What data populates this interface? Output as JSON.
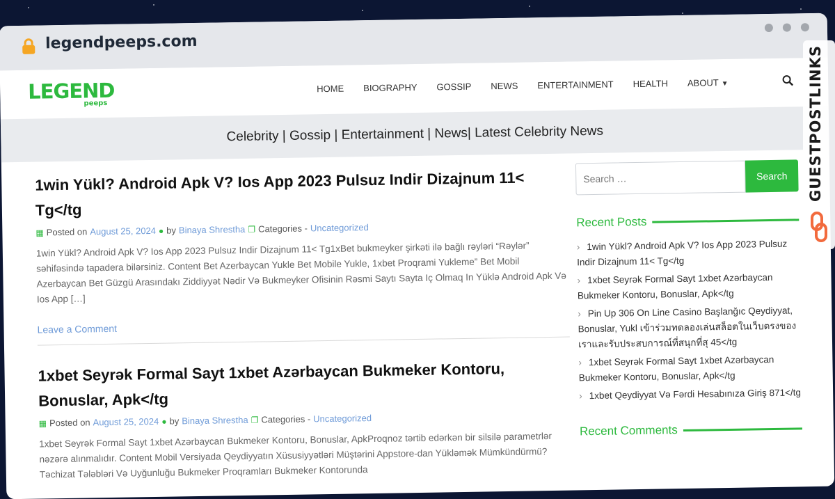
{
  "browser": {
    "address": "legendpeeps.com"
  },
  "site": {
    "logo_text": "LEGEND",
    "logo_subtext": "peeps",
    "nav": [
      "HOME",
      "BIOGRAPHY",
      "GOSSIP",
      "NEWS",
      "ENTERTAINMENT",
      "HEALTH",
      "ABOUT"
    ],
    "tagline": "Celebrity | Gossip | Entertainment | News| Latest Celebrity News"
  },
  "posts": [
    {
      "title": "1win Yükl? Android Apk V? Ios App 2023 Pulsuz Indir Dizajnum 11< Tg</tg",
      "posted_on_label": "Posted on",
      "date": "August 25, 2024",
      "by_label": "by",
      "author": "Binaya Shrestha",
      "categories_label": "Categories -",
      "category": "Uncategorized",
      "excerpt": "1win Yükl? Android Apk V? Ios App 2023 Pulsuz Indir Dizajnum 11< Tg1xBet bukmeyker şirkəti ilə bağlı rəyləri “Rəylər” səhifəsində tapadera bilərsiniz. Content Bet Azerbaycan Yukle Bet Mobile Yukle, 1xbet Proqrami Yukleme” Bet Mobil Azerbaycan Bet Güzgü Arasındakı Ziddiyyət Nədir Və Bukmeyker Ofisinin Rəsmi Saytı Sayta Iç Olmaq In Yüklə Android Apk Və Ios App […]",
      "comment_link": "Leave a Comment"
    },
    {
      "title": "1xbet Seyrək Formal Sayt 1xbet Azərbaycan Bukmeker Kontoru, Bonuslar, Apk</tg",
      "posted_on_label": "Posted on",
      "date": "August 25, 2024",
      "by_label": "by",
      "author": "Binaya Shrestha",
      "categories_label": "Categories -",
      "category": "Uncategorized",
      "excerpt": "1xbet Seyrək Formal Sayt 1xbet Azərbaycan Bukmeker Kontoru, Bonuslar, ApkProqnoz tərtib edərkən bir silsilə parametrlər nəzərə alınmalıdır. Content Mobil Versiyada Qeydiyyatın Xüsusiyyətləri Müştərini Appstore-dan Yükləmək Mümkündürmü? Təchizat Tələbləri Və Uyğunluğu Bukmeker Proqramları Bukmeker Kontorunda"
    }
  ],
  "sidebar": {
    "search_placeholder": "Search …",
    "search_button": "Search",
    "recent_posts_title": "Recent Posts",
    "recent_posts": [
      "1win Yükl? Android Apk V? Ios App 2023 Pulsuz Indir Dizajnum 11< Tg</tg",
      "1xbet Seyrək Formal Sayt 1xbet Azərbaycan Bukmeker Kontoru, Bonuslar, Apk</tg",
      "Pin Up 306 On Line Casino Başlanğıc Qeydiyyat, Bonuslar, Yukl เข้าร่วมทดลองเล่นสล็อตในเว็บตรงของเราและรับประสบการณ์ที่สนุกที่สุ 45</tg",
      "1xbet Seyrək Formal Sayt 1xbet Azərbaycan Bukmeker Kontoru, Bonuslar, Apk</tg",
      "1xbet Qeydiyyat Və Fərdi Hesabınıza Giriş 871</tg"
    ],
    "recent_comments_title": "Recent Comments"
  },
  "badge": {
    "text": "GUESTPOSTLINKS"
  },
  "colors": {
    "brand_green": "#2db93e",
    "link_blue": "#6f9bd8",
    "page_background": "#0c1633"
  }
}
